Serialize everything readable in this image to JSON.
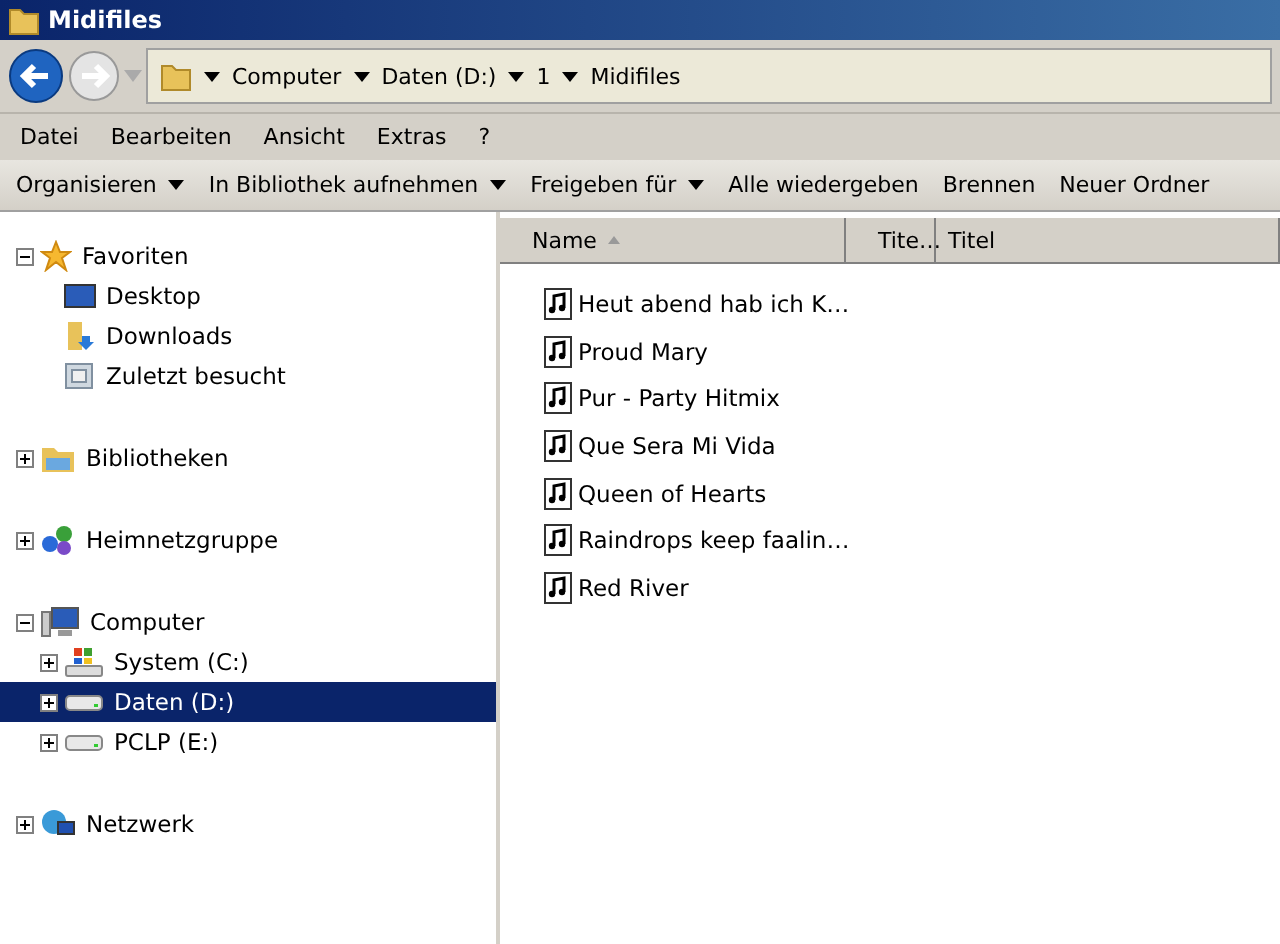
{
  "window": {
    "title": "Midifiles"
  },
  "address": {
    "crumbs": [
      "Computer",
      "Daten (D:)",
      "1",
      "Midifiles"
    ]
  },
  "menu": [
    "Datei",
    "Bearbeiten",
    "Ansicht",
    "Extras",
    "?"
  ],
  "commands": [
    {
      "label": "Organisieren",
      "dropdown": true
    },
    {
      "label": "In Bibliothek aufnehmen",
      "dropdown": true
    },
    {
      "label": "Freigeben für",
      "dropdown": true
    },
    {
      "label": "Alle wiedergeben",
      "dropdown": false
    },
    {
      "label": "Brennen",
      "dropdown": false
    },
    {
      "label": "Neuer Ordner",
      "dropdown": false
    }
  ],
  "sidebar": {
    "groups": [
      {
        "label": "Favoriten",
        "kind": "star",
        "expanded": true,
        "selected": false,
        "children": [
          {
            "label": "Desktop",
            "kind": "desktop",
            "selected": false
          },
          {
            "label": "Downloads",
            "kind": "downloads",
            "selected": false
          },
          {
            "label": "Zuletzt besucht",
            "kind": "recent",
            "selected": false
          }
        ]
      },
      {
        "label": "Bibliotheken",
        "kind": "library",
        "expanded": false,
        "selected": false
      },
      {
        "label": "Heimnetzgruppe",
        "kind": "homegroup",
        "expanded": false,
        "selected": false
      },
      {
        "label": "Computer",
        "kind": "computer",
        "expanded": true,
        "selected": false,
        "children": [
          {
            "label": "System (C:)",
            "kind": "windrive",
            "expanded": false,
            "selected": false
          },
          {
            "label": "Daten (D:)",
            "kind": "drive",
            "expanded": false,
            "selected": true
          },
          {
            "label": "PCLP (E:)",
            "kind": "drive",
            "expanded": false,
            "selected": false
          }
        ]
      },
      {
        "label": "Netzwerk",
        "kind": "network",
        "expanded": false,
        "selected": false
      }
    ]
  },
  "table": {
    "columns": [
      "Name",
      "Tite…",
      "Titel"
    ],
    "rows": [
      "Heut abend hab ich K…",
      "Proud Mary",
      "Pur - Party Hitmix",
      "Que Sera Mi Vida",
      "Queen of Hearts",
      "Raindrops keep faalin…",
      "Red River"
    ]
  }
}
